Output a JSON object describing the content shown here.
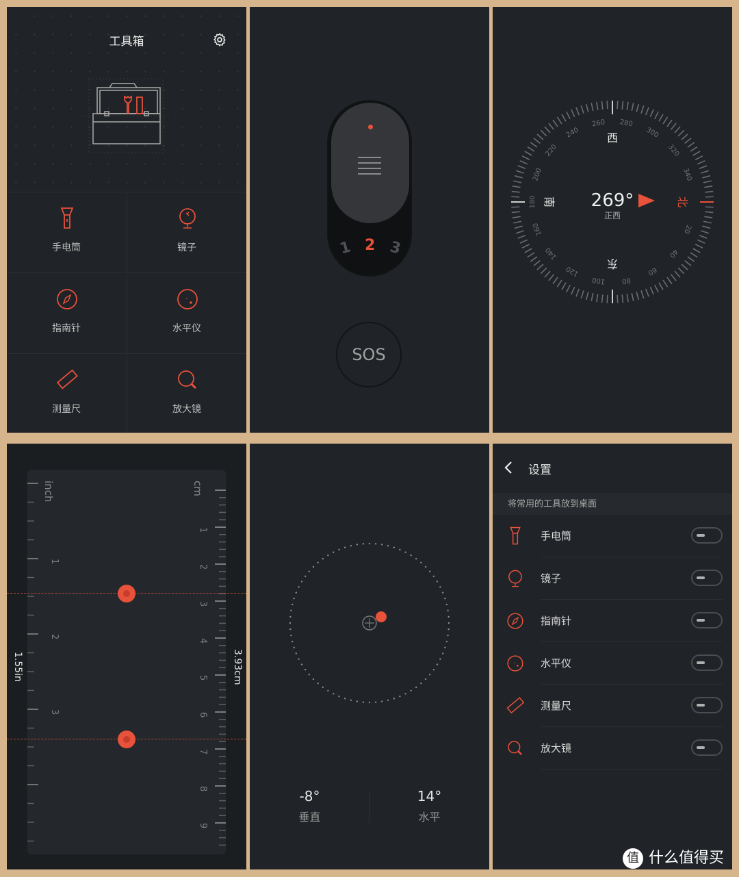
{
  "colors": {
    "accent": "#e8513a",
    "frame": "#d6b58c",
    "panel_bg": "#202327"
  },
  "toolbox": {
    "title": "工具箱",
    "settings_icon": "gear-icon",
    "tools": [
      {
        "label": "手电筒",
        "icon": "flashlight-icon"
      },
      {
        "label": "镜子",
        "icon": "mirror-icon"
      },
      {
        "label": "指南针",
        "icon": "compass-icon"
      },
      {
        "label": "水平仪",
        "icon": "level-icon"
      },
      {
        "label": "测量尺",
        "icon": "ruler-icon"
      },
      {
        "label": "放大镜",
        "icon": "magnifier-icon"
      }
    ]
  },
  "flashlight": {
    "levels": [
      "1",
      "2",
      "3"
    ],
    "active_level": "2",
    "sos_label": "SOS"
  },
  "compass": {
    "heading": "269°",
    "direction_label": "正西",
    "cardinals": {
      "top": "西",
      "left": "南",
      "right": "北",
      "bottom": "东"
    },
    "tick_labels": [
      "20",
      "40",
      "60",
      "80",
      "100",
      "120",
      "140",
      "160",
      "180",
      "200",
      "220",
      "240",
      "260",
      "280",
      "300",
      "320",
      "340"
    ]
  },
  "ruler": {
    "inch_unit": "inch",
    "cm_unit": "cm",
    "inch_labels": [
      "1",
      "2",
      "3"
    ],
    "cm_labels": [
      "1",
      "2",
      "3",
      "4",
      "5",
      "6",
      "7",
      "8",
      "9"
    ],
    "inch_reading": "1.55in",
    "cm_reading": "3.93cm"
  },
  "level": {
    "vertical_value": "-8°",
    "vertical_label": "垂直",
    "horizontal_value": "14°",
    "horizontal_label": "水平"
  },
  "settings": {
    "title": "设置",
    "section_label": "将常用的工具放到桌面",
    "items": [
      {
        "label": "手电筒",
        "enabled": false
      },
      {
        "label": "镜子",
        "enabled": false
      },
      {
        "label": "指南针",
        "enabled": false
      },
      {
        "label": "水平仪",
        "enabled": false
      },
      {
        "label": "测量尺",
        "enabled": false
      },
      {
        "label": "放大镜",
        "enabled": false
      }
    ]
  },
  "watermark": {
    "logo": "值",
    "text": "什么值得买"
  }
}
